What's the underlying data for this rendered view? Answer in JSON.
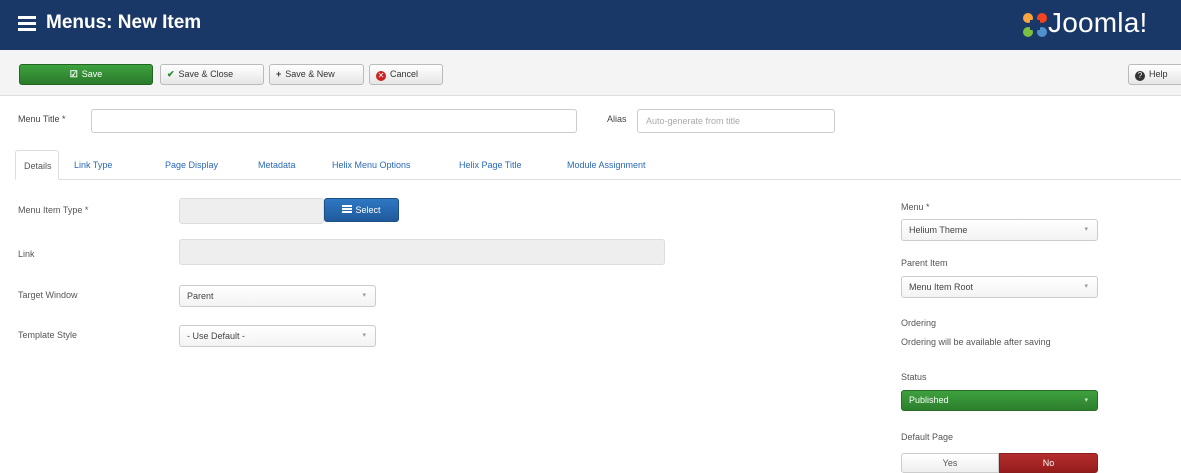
{
  "header": {
    "title": "Menus: New Item",
    "logo_text": "Joomla!",
    "background": "#1a3867"
  },
  "toolbar": {
    "save_label": "Save",
    "save_close_label": "Save & Close",
    "save_new_label": "Save & New",
    "cancel_label": "Cancel",
    "help_label": "Help",
    "save_color": "#2b8a2b"
  },
  "title_row": {
    "menu_title_label": "Menu Title *",
    "menu_title_value": "",
    "alias_label": "Alias",
    "alias_placeholder": "Auto-generate from title"
  },
  "tabs": [
    {
      "label": "Details",
      "active": true
    },
    {
      "label": "Link Type"
    },
    {
      "label": "Page Display"
    },
    {
      "label": "Metadata"
    },
    {
      "label": "Helix Menu Options"
    },
    {
      "label": "Helix Page Title"
    },
    {
      "label": "Module Assignment"
    }
  ],
  "form": {
    "menu_item_type_label": "Menu Item Type *",
    "menu_item_type_value": "",
    "select_button_label": "Select",
    "link_label": "Link",
    "link_value": "",
    "target_window_label": "Target Window",
    "target_window_value": "Parent",
    "template_style_label": "Template Style",
    "template_style_value": "- Use Default -"
  },
  "sidebar": {
    "menu_label": "Menu *",
    "menu_value": "Helium Theme",
    "parent_item_label": "Parent Item",
    "parent_item_value": "Menu Item Root",
    "ordering_label": "Ordering",
    "ordering_note": "Ordering will be available after saving",
    "status_label": "Status",
    "status_value": "Published",
    "status_color": "#3a9a3a",
    "default_page_label": "Default Page",
    "default_yes": "Yes",
    "default_no": "No",
    "default_selected": "No",
    "no_color": "#a52525"
  }
}
